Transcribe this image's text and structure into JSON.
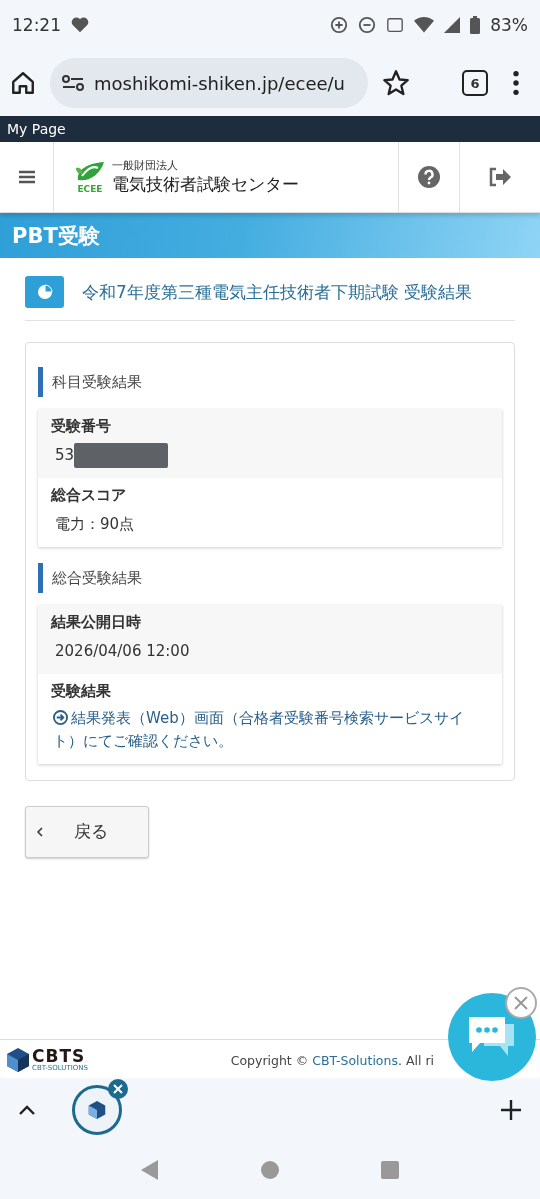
{
  "status_bar": {
    "time": "12:21",
    "battery": "83%"
  },
  "browser": {
    "url": "moshikomi-shiken.jp/ecee/u",
    "tab_count": "6"
  },
  "top_bar": {
    "title": "My Page"
  },
  "header": {
    "logo_mark": "ECEE",
    "org_type": "一般財団法人",
    "org_name": "電気技術者試験センター"
  },
  "banner": {
    "title": "PBT受験"
  },
  "page_title": "令和7年度第三種電気主任技術者下期試験 受験結果",
  "sections": [
    {
      "heading": "科目受験結果",
      "fields": [
        {
          "label": "受験番号",
          "value": "53",
          "kind": "redacted"
        },
        {
          "label": "総合スコア",
          "value": "電力：90点",
          "kind": "text"
        }
      ]
    },
    {
      "heading": "総合受験結果",
      "fields": [
        {
          "label": "結果公開日時",
          "value": "2026/04/06 12:00",
          "kind": "text"
        },
        {
          "label": "受験結果",
          "value": "結果発表（Web）画面（合格者受験番号検索サービスサイト）にてご確認ください。",
          "kind": "link"
        }
      ]
    }
  ],
  "back_button": {
    "label": "戻る"
  },
  "footer": {
    "logo": "CBTS",
    "logo_sub": "CBT-SOLUTIONS",
    "copyright_prefix": "Copyright ©",
    "copyright_link": "CBT-Solutions",
    "copyright_suffix": ". All ri"
  }
}
